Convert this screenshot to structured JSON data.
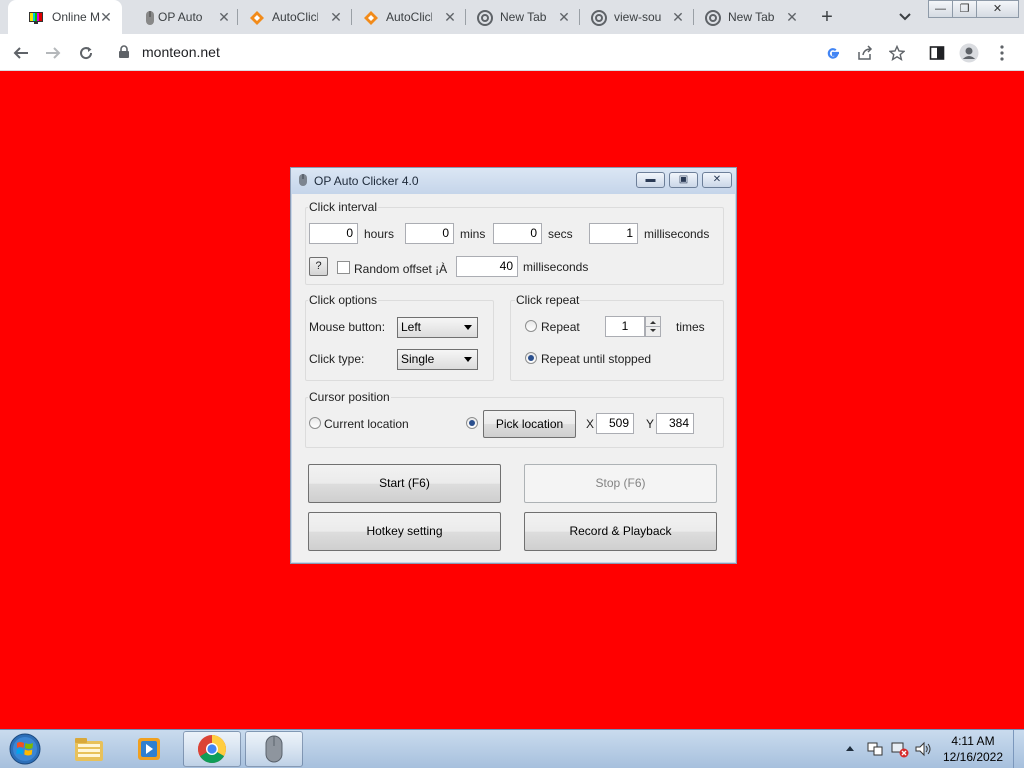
{
  "browser": {
    "tabs": [
      {
        "title": "Online M",
        "active": true,
        "icon": "monitor-icon"
      },
      {
        "title": "OP Auto",
        "active": false,
        "icon": "mouse-icon"
      },
      {
        "title": "AutoClick",
        "active": false,
        "icon": "diamond-icon"
      },
      {
        "title": "AutoClick",
        "active": false,
        "icon": "diamond-icon"
      },
      {
        "title": "New Tab",
        "active": false,
        "icon": "chrome-icon"
      },
      {
        "title": "view-sou",
        "active": false,
        "icon": "chrome-icon"
      },
      {
        "title": "New Tab",
        "active": false,
        "icon": "chrome-icon"
      }
    ],
    "new_tab_symbol": "+",
    "window_controls": {
      "minimize": "—",
      "restore": "❐",
      "close": "✕"
    },
    "url": "monteon.net"
  },
  "page": {
    "background_color": "#ff0000"
  },
  "dialog": {
    "title": "OP Auto Clicker 4.0",
    "click_interval": {
      "label": "Click interval",
      "hours": {
        "value": "0",
        "unit": "hours"
      },
      "mins": {
        "value": "0",
        "unit": "mins"
      },
      "secs": {
        "value": "0",
        "unit": "secs"
      },
      "milliseconds": {
        "value": "1",
        "unit": "milliseconds"
      },
      "help_button": "?",
      "random_offset_label": "Random offset ¡À",
      "random_offset_checked": false,
      "random_offset_value": "40",
      "random_offset_unit": "milliseconds"
    },
    "click_options": {
      "label": "Click options",
      "mouse_button_label": "Mouse button:",
      "mouse_button_value": "Left",
      "click_type_label": "Click type:",
      "click_type_value": "Single"
    },
    "click_repeat": {
      "label": "Click repeat",
      "repeat_label": "Repeat",
      "repeat_value": "1",
      "times_label": "times",
      "repeat_until_stopped_label": "Repeat until stopped",
      "selected": "repeat_until_stopped"
    },
    "cursor_position": {
      "label": "Cursor position",
      "current_location_label": "Current location",
      "pick_location_button": "Pick location",
      "x_label": "X",
      "x_value": "509",
      "y_label": "Y",
      "y_value": "384",
      "selected": "pick_location"
    },
    "buttons": {
      "start": "Start (F6)",
      "stop": "Stop (F6)",
      "hotkey": "Hotkey setting",
      "record": "Record & Playback"
    }
  },
  "taskbar": {
    "clock_time": "4:11 AM",
    "clock_date": "12/16/2022",
    "pinned": [
      "explorer-icon",
      "media-player-icon",
      "chrome-icon",
      "mouse-icon"
    ]
  }
}
